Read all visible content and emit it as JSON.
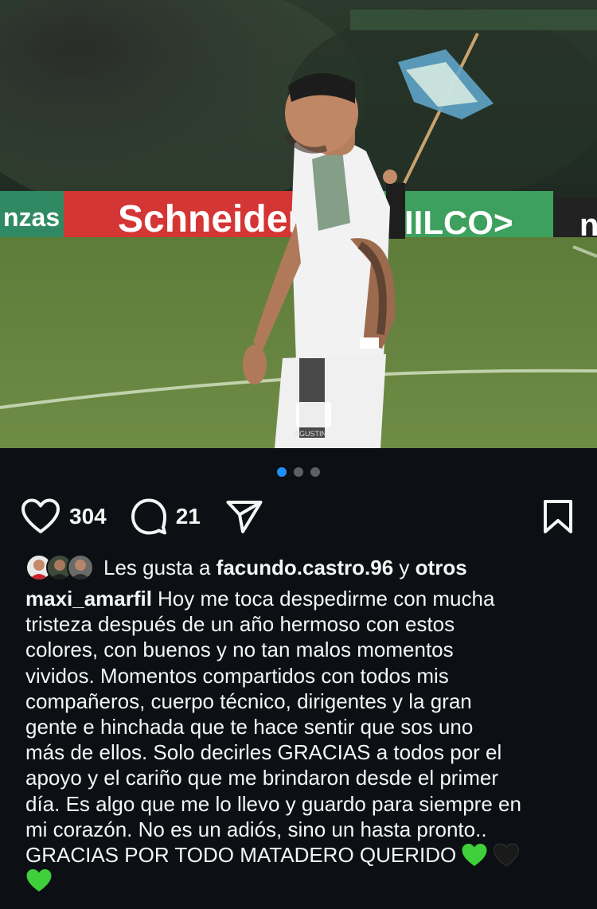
{
  "post": {
    "image": {
      "alt": "Soccer player in white and green kit walking on the pitch",
      "banner_left": "nzas",
      "banner_main": "Schneider",
      "banner_right": "IILCO>",
      "banner_far_right": "n",
      "watermark_sub": "AGUSTIN",
      "carousel_total": 3,
      "carousel_active": 0
    },
    "actions": {
      "likes_count": "304",
      "comments_count": "21"
    },
    "likes_line": {
      "prefix": "Les gusta a",
      "user": "facundo.castro.96",
      "connector": "y",
      "others": "otros"
    },
    "caption": {
      "username": "maxi_amarfil",
      "lines": [
        "Hoy me toca despedirme con mucha",
        "tristeza después de un año hermoso con estos",
        "colores, con buenos y no tan malos momentos",
        "vividos. Momentos compartidos con todos mis",
        "compañeros, cuerpo técnico, dirigentes y la gran",
        "gente e hinchada que te hace sentir que sos uno",
        "más de ellos. Solo decirles GRACIAS  a todos por el",
        "apoyo y el cariño que me brindaron desde el primer",
        "día. Es algo que me lo llevo y guardo para siempre en",
        "mi corazón. No es un adiós, sino un hasta pronto..",
        "GRACIAS POR TODO MATADERO QUERIDO"
      ],
      "emojis": [
        "green-heart",
        "black-heart",
        "green-heart"
      ]
    },
    "colors": {
      "background": "#0c1014",
      "accent_dot": "#1e90ff",
      "green_heart": "#3fcf3a",
      "black_heart": "#1a1a1a"
    }
  }
}
